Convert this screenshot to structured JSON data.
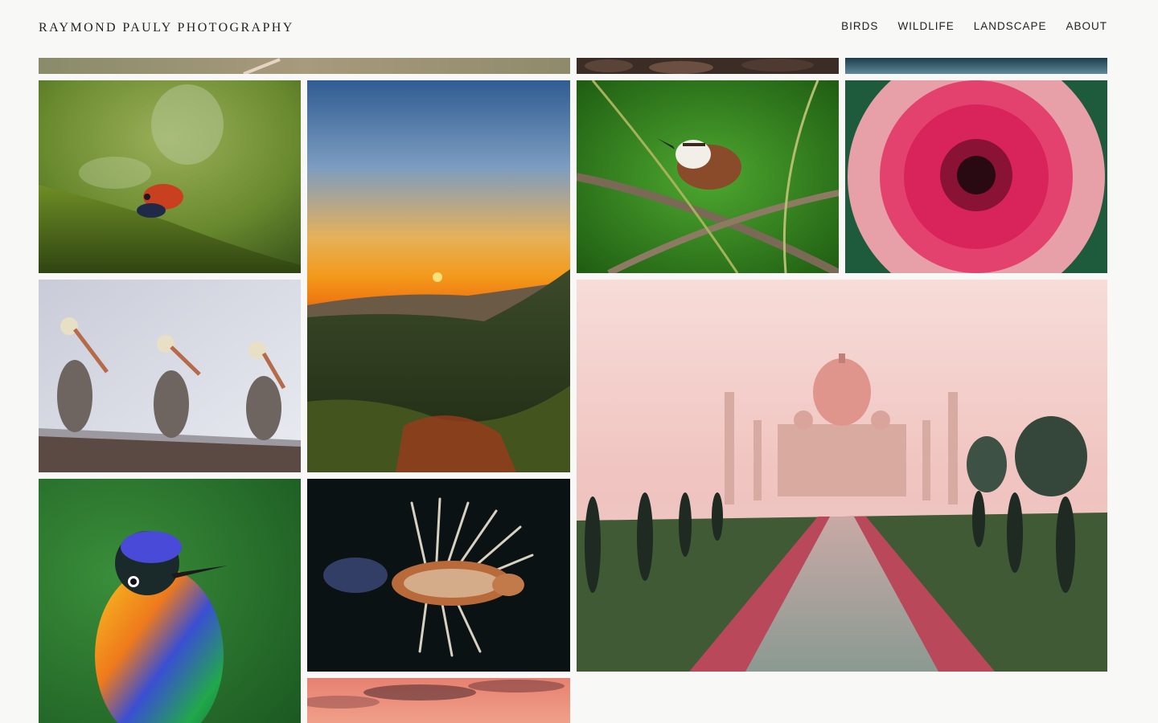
{
  "site": {
    "title": "RAYMOND PAULY PHOTOGRAPHY"
  },
  "nav": [
    {
      "label": "BIRDS"
    },
    {
      "label": "WILDLIFE"
    },
    {
      "label": "LANDSCAPE"
    },
    {
      "label": "ABOUT"
    }
  ],
  "gallery": {
    "photos": [
      {
        "subject": "bird on branch (partially visible)"
      },
      {
        "subject": "rocks (partially visible)"
      },
      {
        "subject": "water (partially visible)"
      },
      {
        "subject": "red poison dart frog on moss"
      },
      {
        "subject": "mountain sunset"
      },
      {
        "subject": "wren on branch"
      },
      {
        "subject": "pink gerbera flower"
      },
      {
        "subject": "three pelicans on roof"
      },
      {
        "subject": "Taj Mahal at dawn"
      },
      {
        "subject": "hummingbird"
      },
      {
        "subject": "lionfish"
      },
      {
        "subject": "sunset sky (partially visible)"
      }
    ]
  }
}
